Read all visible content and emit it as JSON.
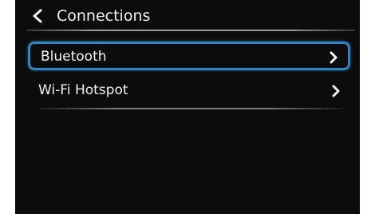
{
  "header": {
    "title": "Connections",
    "back_icon": "chevron-left-icon"
  },
  "menu": {
    "items": [
      {
        "label": "Bluetooth",
        "selected": true,
        "icon": "chevron-right-icon"
      },
      {
        "label": "Wi-Fi Hotspot",
        "selected": false,
        "icon": "chevron-right-icon"
      }
    ]
  },
  "colors": {
    "background": "#0c0c0c",
    "text": "#f2f2f2",
    "selection_border": "#2f86c4"
  }
}
